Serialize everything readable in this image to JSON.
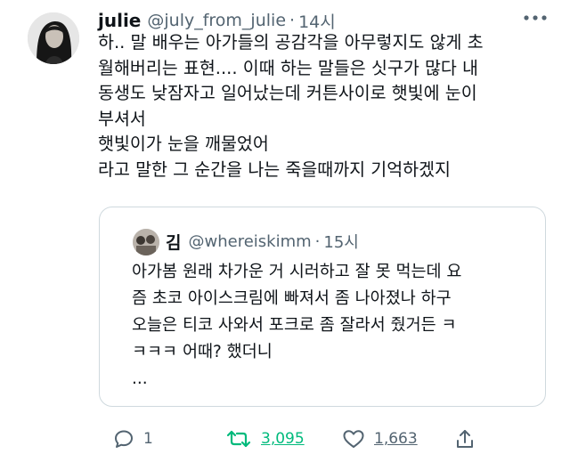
{
  "tweet": {
    "author_name": "julie",
    "handle": "@july_from_julie",
    "separator": "·",
    "time": "14시",
    "lines": [
      "하.. 말 배우는 아가들의 공감각을 아무렇지도 않게 초",
      "월해버리는 표현.... 이때 하는 말들은 싯구가 많다 내",
      "동생도 낮잠자고 일어났는데 커튼사이로 햇빛에 눈이",
      "부셔서",
      "햇빛이가 눈을 깨물었어",
      "라고 말한 그 순간을 나는 죽을때까지 기억하겠지"
    ]
  },
  "quote": {
    "author_name": "김",
    "handle": "@whereiskimm",
    "separator": "·",
    "time": "15시",
    "lines": [
      "아가봄 원래 차가운 거 시러하고 잘 못 먹는데 요",
      "즘 초코 아이스크림에 빠져서 좀 나아졌나 하구",
      "오늘은 티코 사와서 포크로 좀 잘라서 줬거든 ㅋ",
      "ㅋㅋㅋ 어때? 했더니",
      "..."
    ]
  },
  "actions": {
    "reply_count": "1",
    "retweet_count": "3,095",
    "like_count": "1,663"
  },
  "icons": {
    "more": "more-horizontal-icon",
    "reply": "reply-bubble-icon",
    "retweet": "retweet-arrows-icon",
    "like": "heart-outline-icon",
    "share": "share-upload-icon"
  },
  "colors": {
    "text": "#0f1419",
    "secondary": "#536471",
    "retweet_active": "#00ba7c",
    "border": "#cfd9de"
  }
}
